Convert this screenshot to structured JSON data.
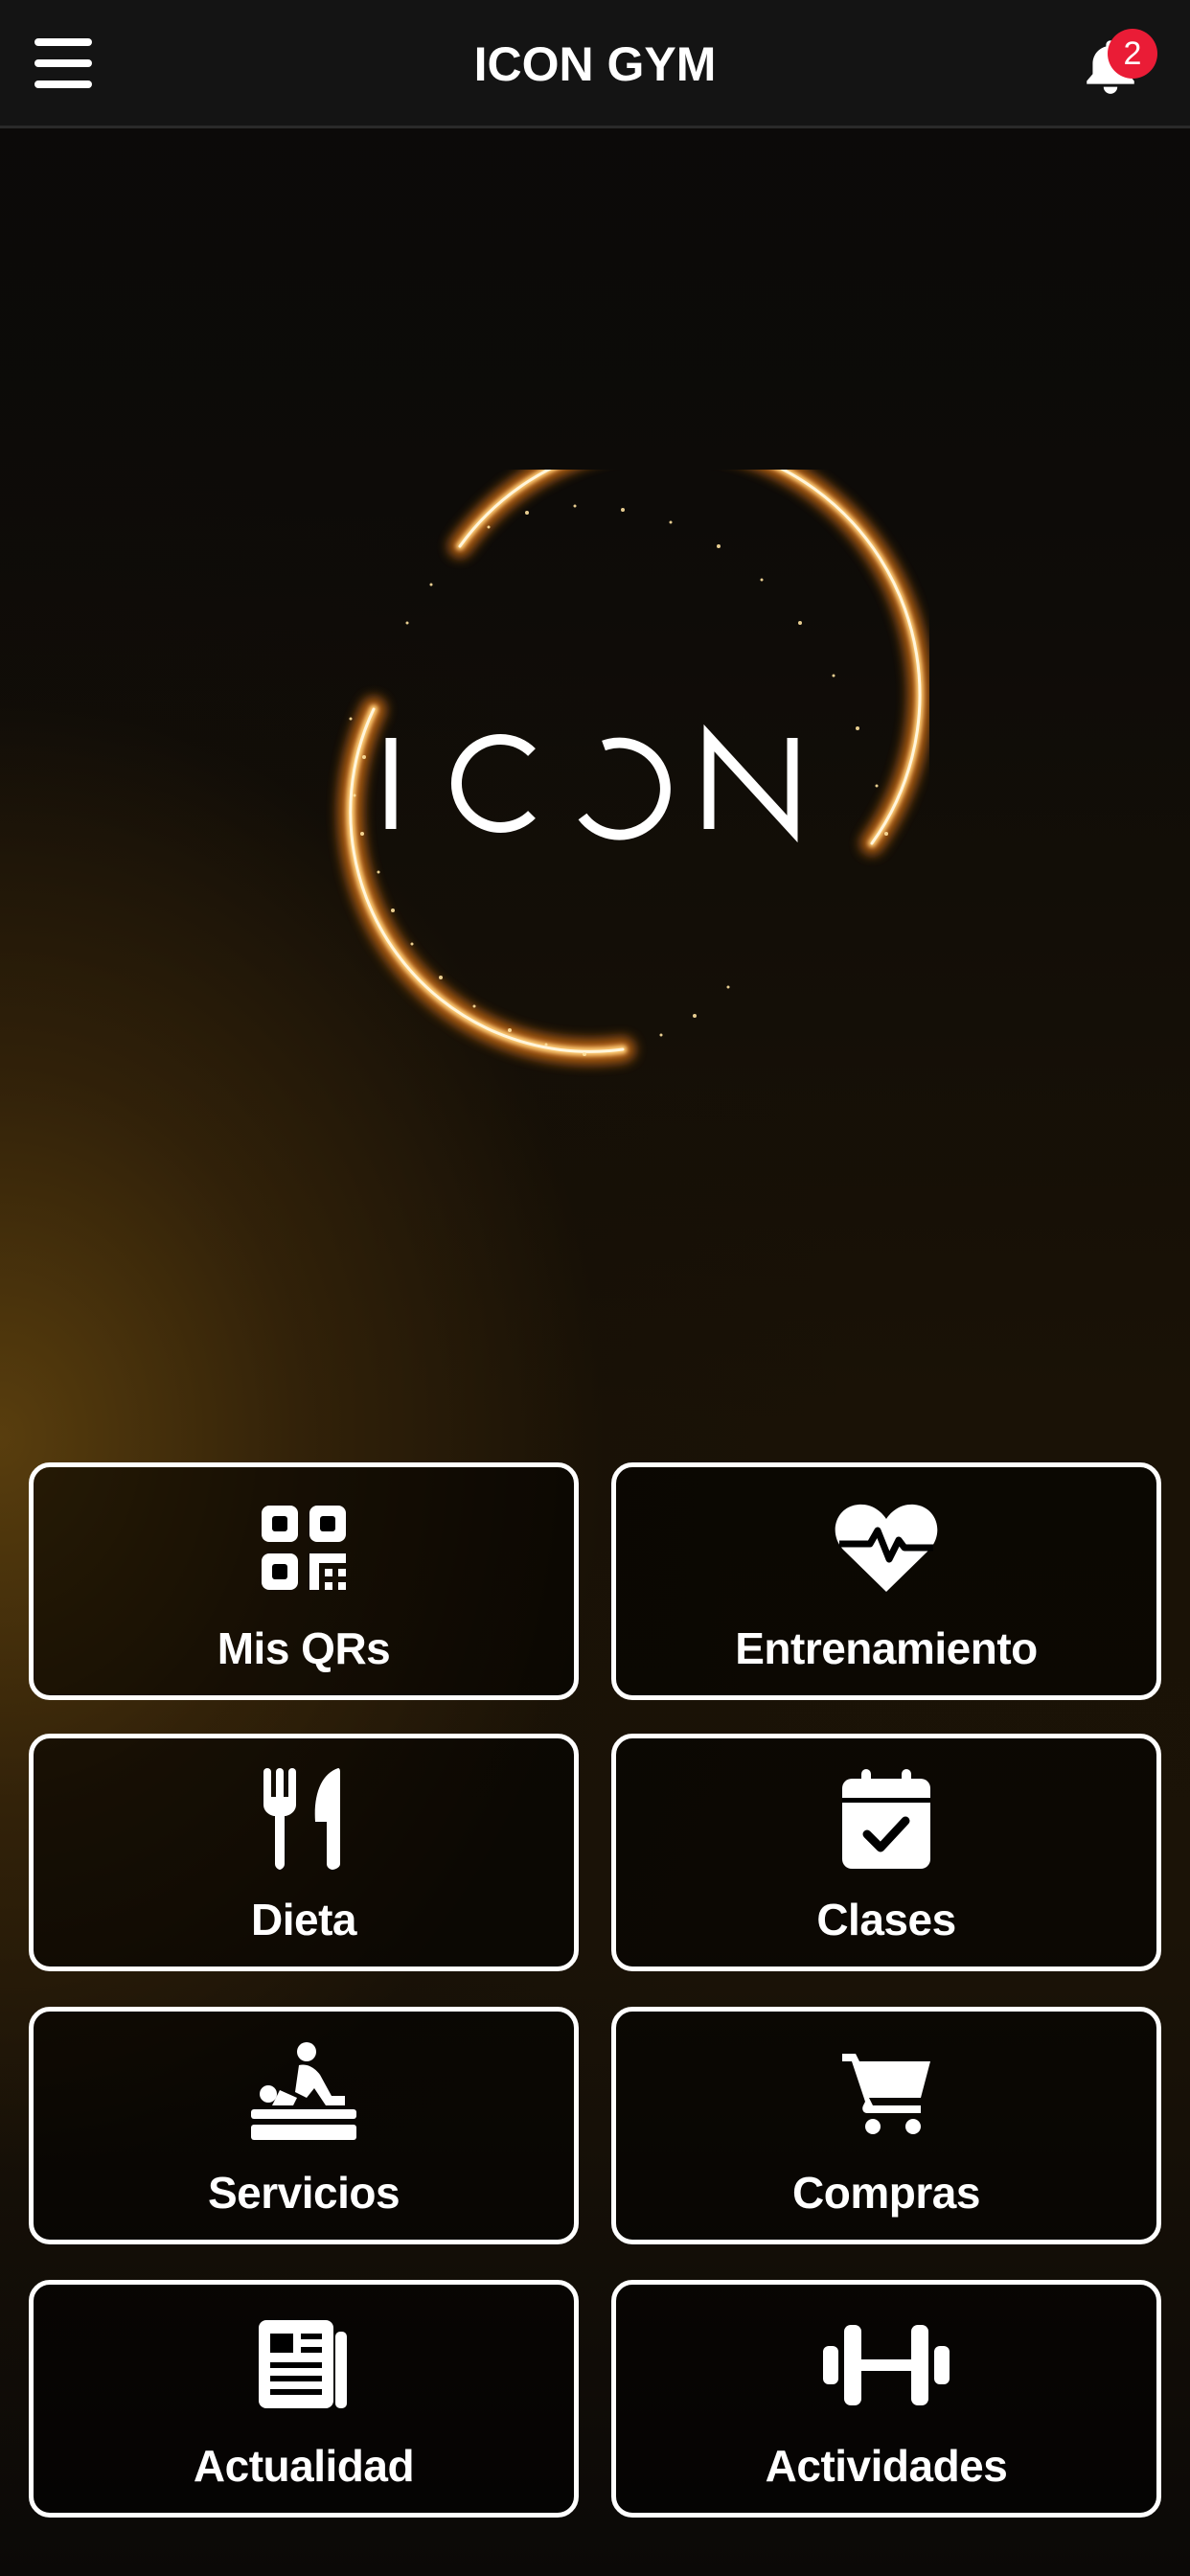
{
  "header": {
    "title": "ICON GYM",
    "notification_count": "2"
  },
  "logo": {
    "text": "ICON"
  },
  "menu": {
    "tiles": [
      {
        "label": "Mis QRs",
        "icon": "qr-code-icon"
      },
      {
        "label": "Entrenamiento",
        "icon": "heart-pulse-icon"
      },
      {
        "label": "Dieta",
        "icon": "utensils-icon"
      },
      {
        "label": "Clases",
        "icon": "calendar-check-icon"
      },
      {
        "label": "Servicios",
        "icon": "massage-icon"
      },
      {
        "label": "Compras",
        "icon": "shopping-cart-icon"
      },
      {
        "label": "Actualidad",
        "icon": "newspaper-icon"
      },
      {
        "label": "Actividades",
        "icon": "dumbbell-icon"
      }
    ]
  },
  "colors": {
    "badge": "#ea1c36",
    "accent_gold": "#f0a23a"
  }
}
